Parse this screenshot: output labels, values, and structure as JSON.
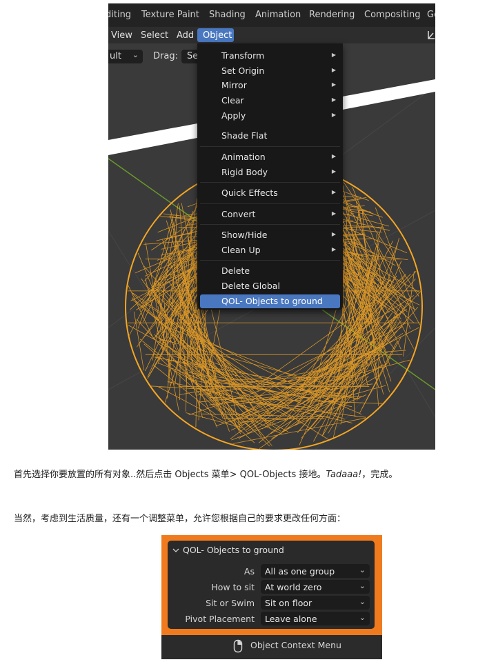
{
  "workspace_tabs": [
    "diting",
    "Texture Paint",
    "Shading",
    "Animation",
    "Rendering",
    "Compositing",
    "Ge"
  ],
  "menubar": {
    "view": "View",
    "select": "Select",
    "add": "Add",
    "object": "Object"
  },
  "header2": {
    "mode_value": "ult",
    "drag_label": "Drag:",
    "drag_value": "Se"
  },
  "object_menu": {
    "items": [
      {
        "label": "Transform",
        "submenu": true
      },
      {
        "label": "Set Origin",
        "submenu": true
      },
      {
        "label": "Mirror",
        "submenu": true
      },
      {
        "label": "Clear",
        "submenu": true
      },
      {
        "label": "Apply",
        "submenu": true
      },
      {
        "label": "Shade Flat",
        "submenu": false
      },
      {
        "label": "Animation",
        "submenu": true
      },
      {
        "label": "Rigid Body",
        "submenu": true
      },
      {
        "label": "Quick Effects",
        "submenu": true
      },
      {
        "label": "Convert",
        "submenu": true
      },
      {
        "label": "Show/Hide",
        "submenu": true
      },
      {
        "label": "Clean Up",
        "submenu": true
      },
      {
        "label": "Delete",
        "submenu": false
      },
      {
        "label": "Delete Global",
        "submenu": false
      },
      {
        "label": "QOL- Objects to ground",
        "submenu": false,
        "highlighted": true
      }
    ]
  },
  "article": {
    "para1_a": "首先选择你要放置的所有对象..然后点击 Objects 菜单> QOL-Objects 接地。",
    "para1_em": "Tadaaa!",
    "para1_b": "，完成。",
    "para2": "当然，考虑到生活质量，还有一个调整菜单，允许您根据自己的要求更改任何方面："
  },
  "adjust_panel": {
    "title": "QOL- Objects to ground",
    "rows": [
      {
        "label": "As",
        "value": "All as one group"
      },
      {
        "label": "How to sit",
        "value": "At world zero"
      },
      {
        "label": "Sit or Swim",
        "value": "Sit on floor"
      },
      {
        "label": "Pivot Placement",
        "value": "Leave alone"
      }
    ],
    "status_text": "Object Context Menu"
  },
  "colors": {
    "highlight": "#4a78c0",
    "wireframe": "#f5a623",
    "panel_border": "#f07b1e",
    "viewport_bg": "#3a3a3a"
  }
}
